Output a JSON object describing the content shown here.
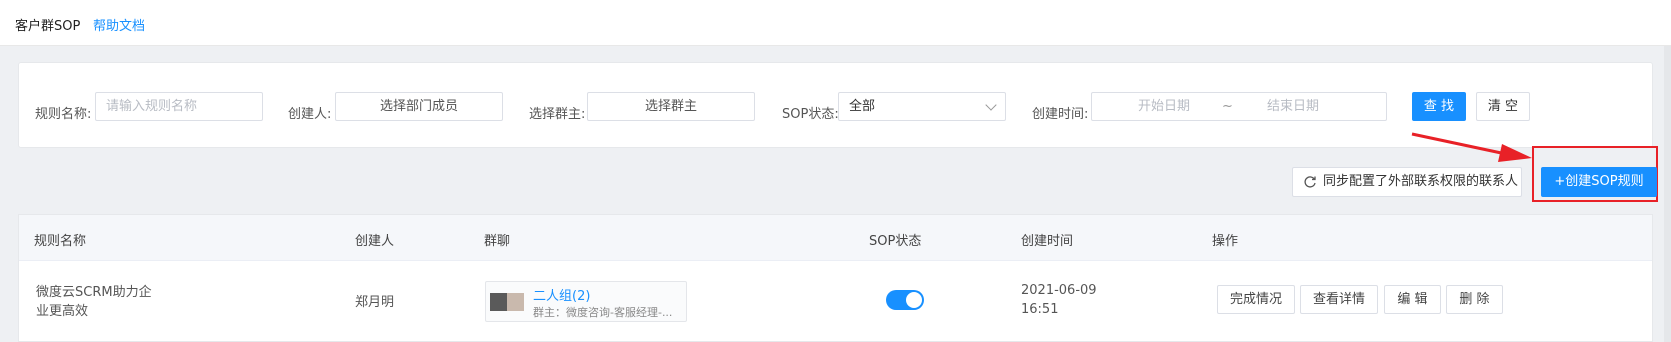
{
  "header": {
    "title": "客户群SOP",
    "help_link": "帮助文档"
  },
  "filters": {
    "rule_name_label": "规则名称:",
    "rule_name_placeholder": "请输入规则名称",
    "creator_label": "创建人:",
    "creator_value": "选择部门成员",
    "group_owner_label": "选择群主:",
    "group_owner_value": "选择群主",
    "sop_status_label": "SOP状态:",
    "sop_status_value": "全部",
    "created_time_label": "创建时间:",
    "start_date_placeholder": "开始日期",
    "date_separator": "~",
    "end_date_placeholder": "结束日期",
    "search_button": "查 找",
    "clear_button": "清 空"
  },
  "actions": {
    "sync_button": "同步配置了外部联系权限的联系人",
    "create_button": "+创建SOP规则"
  },
  "table": {
    "columns": [
      "规则名称",
      "创建人",
      "群聊",
      "SOP状态",
      "创建时间",
      "操作"
    ],
    "rows": [
      {
        "rule_name_line1": "微度云SCRM助力企",
        "rule_name_line2": "业更高效",
        "creator": "郑月明",
        "group_name": "二人组(2)",
        "group_owner": "群主：微度咨询-客服经理-...",
        "sop_enabled": true,
        "created_date": "2021-06-09",
        "created_time": "16:51",
        "ops": [
          "完成情况",
          "查看详情",
          "编 辑",
          "删 除"
        ]
      }
    ]
  },
  "colors": {
    "primary": "#1890ff",
    "highlight": "#e82127"
  }
}
